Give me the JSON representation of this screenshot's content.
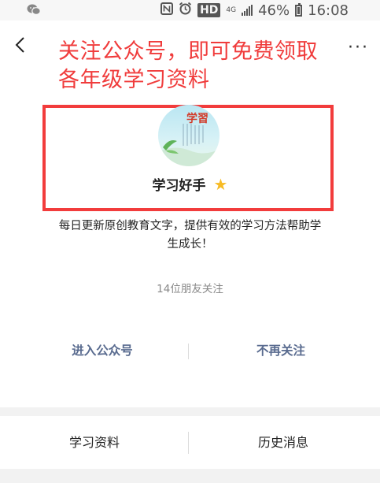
{
  "status_bar": {
    "app_icon": "wechat-icon",
    "status_icons": [
      "nfc-icon",
      "alarm-icon"
    ],
    "hd_label": "HD",
    "network_label": "4G",
    "battery_percent": "46%",
    "time": "16:08"
  },
  "header": {
    "back_icon": "chevron-left-icon",
    "more_label": "···"
  },
  "promo": {
    "line1": "关注公众号，即可免费领取",
    "line2": "各年级学习资料"
  },
  "account": {
    "avatar_text": "学習",
    "name": "学习好手",
    "badge_icon": "star-icon",
    "badge_color": "#f7bb24",
    "description": "每日更新原创教育文字，提供有效的学习方法帮助学生成长！",
    "followers": "14位朋友关注"
  },
  "actions": {
    "enter_label": "进入公众号",
    "unfollow_label": "不再关注"
  },
  "menu": {
    "items": [
      {
        "label": "学习资料"
      },
      {
        "label": "历史消息"
      }
    ]
  },
  "colors": {
    "promo_red": "#f03c3c",
    "link_blue": "#596b8f",
    "star_gold": "#f7bb24"
  }
}
